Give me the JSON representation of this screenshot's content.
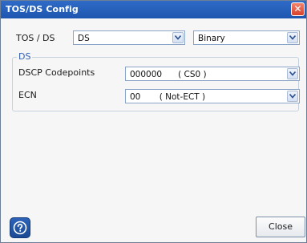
{
  "window": {
    "title": "TOS/DS Config",
    "close_glyph": "✕"
  },
  "tos_ds": {
    "label": "TOS / DS",
    "mode_value": "DS",
    "format_value": "Binary"
  },
  "ds_group": {
    "legend": "DS",
    "dscp": {
      "label": "DSCP Codepoints",
      "value": "000000      ( CS0 )"
    },
    "ecn": {
      "label": "ECN",
      "value": "00       ( Not-ECT )"
    }
  },
  "footer": {
    "help_icon": "help-icon",
    "close_label": "Close"
  },
  "colors": {
    "titlebar": "#1d56b0",
    "accent": "#2f5fb3",
    "close_red": "#d6402b"
  }
}
